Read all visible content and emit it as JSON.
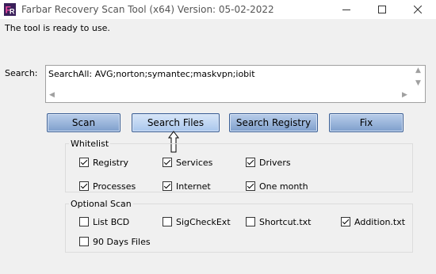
{
  "window": {
    "title": "Farbar Recovery Scan Tool (x64) Version: 05-02-2022",
    "minimize_icon": "minimize-icon",
    "maximize_icon": "maximize-icon",
    "close_icon": "close-icon"
  },
  "status_text": "The tool is ready to use.",
  "search": {
    "label": "Search:",
    "value": "SearchAll: AVG;norton;symantec;maskvpn;iobit"
  },
  "buttons": {
    "scan": "Scan",
    "search_files": "Search Files",
    "search_registry": "Search Registry",
    "fix": "Fix"
  },
  "whitelist": {
    "title": "Whitelist",
    "items": [
      {
        "label": "Registry",
        "checked": true
      },
      {
        "label": "Services",
        "checked": true
      },
      {
        "label": "Drivers",
        "checked": true
      },
      {
        "label": "Processes",
        "checked": true
      },
      {
        "label": "Internet",
        "checked": true
      },
      {
        "label": "One month",
        "checked": true
      }
    ]
  },
  "optional_scan": {
    "title": "Optional Scan",
    "items": [
      {
        "label": "List BCD",
        "checked": false
      },
      {
        "label": "SigCheckExt",
        "checked": false
      },
      {
        "label": "Shortcut.txt",
        "checked": false
      },
      {
        "label": "Addition.txt",
        "checked": true
      },
      {
        "label": "90 Days Files",
        "checked": false
      }
    ]
  },
  "colors": {
    "button_border": "#3b5f95",
    "button_fill": "#7e9fcc",
    "window_bg": "#f0f0f0"
  }
}
